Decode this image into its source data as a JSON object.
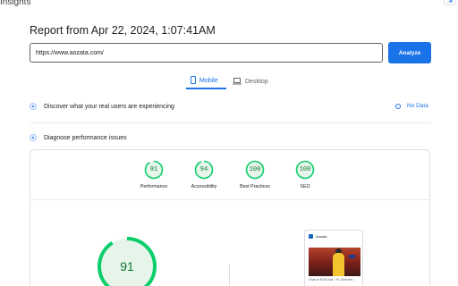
{
  "app": {
    "title": "Insights"
  },
  "report": {
    "title": "Report from Apr 22, 2024, 1:07:41AM"
  },
  "search": {
    "value": "https://www.aozata.com/",
    "analyze_label": "Analyze"
  },
  "tabs": [
    {
      "label": "Mobile",
      "icon": "smartphone-icon",
      "active": true
    },
    {
      "label": "Desktop",
      "icon": "laptop-icon",
      "active": false
    }
  ],
  "field_data": {
    "title": "Discover what your real users are experiencing",
    "status": "No Data"
  },
  "diagnose": {
    "title": "Diagnose performance issues"
  },
  "scores": [
    {
      "value": "91",
      "label": "Performance"
    },
    {
      "value": "94",
      "label": "Accessibility"
    },
    {
      "value": "100",
      "label": "Best Practices"
    },
    {
      "value": "100",
      "label": "SEO"
    }
  ],
  "main_score": {
    "value": "91"
  },
  "preview": {
    "site_name": "Aozata",
    "caption": "Chat on BOB chat · IPL Matches: ..."
  },
  "colors": {
    "accent": "#1a73e8",
    "pass": "#0cce6b",
    "pass_text": "#0c7a2d"
  }
}
